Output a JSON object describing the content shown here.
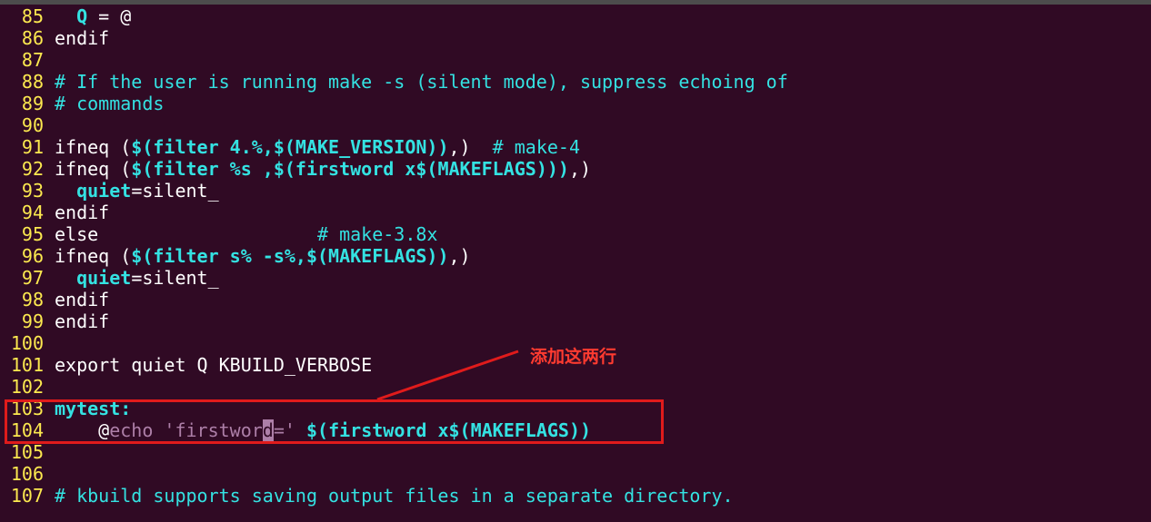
{
  "lines": [
    {
      "no": "85",
      "segs": [
        {
          "t": "  ",
          "c": ""
        },
        {
          "t": "Q",
          "c": "bcy"
        },
        {
          "t": " = @",
          "c": ""
        }
      ]
    },
    {
      "no": "86",
      "segs": [
        {
          "t": "endif",
          "c": "kw"
        }
      ]
    },
    {
      "no": "87",
      "segs": []
    },
    {
      "no": "88",
      "segs": [
        {
          "t": "# If the user is running make -s (silent mode), suppress echoing of",
          "c": "cmt"
        }
      ]
    },
    {
      "no": "89",
      "segs": [
        {
          "t": "# commands",
          "c": "cmt"
        }
      ]
    },
    {
      "no": "90",
      "segs": []
    },
    {
      "no": "91",
      "segs": [
        {
          "t": "ifneq (",
          "c": ""
        },
        {
          "t": "$(filter 4.%,$(MAKE_VERSION))",
          "c": "bcy"
        },
        {
          "t": ",)  ",
          "c": ""
        },
        {
          "t": "# make-4",
          "c": "cmt"
        }
      ]
    },
    {
      "no": "92",
      "segs": [
        {
          "t": "ifneq (",
          "c": ""
        },
        {
          "t": "$(filter %s ,$(firstword x$(MAKEFLAGS)))",
          "c": "bcy"
        },
        {
          "t": ",)",
          "c": ""
        }
      ]
    },
    {
      "no": "93",
      "segs": [
        {
          "t": "  ",
          "c": ""
        },
        {
          "t": "quiet",
          "c": "bcy"
        },
        {
          "t": "=silent_",
          "c": ""
        }
      ]
    },
    {
      "no": "94",
      "segs": [
        {
          "t": "endif",
          "c": "kw"
        }
      ]
    },
    {
      "no": "95",
      "segs": [
        {
          "t": "else                    ",
          "c": "kw"
        },
        {
          "t": "# make-3.8x",
          "c": "cmt"
        }
      ]
    },
    {
      "no": "96",
      "segs": [
        {
          "t": "ifneq (",
          "c": ""
        },
        {
          "t": "$(filter s% -s%,$(MAKEFLAGS))",
          "c": "bcy"
        },
        {
          "t": ",)",
          "c": ""
        }
      ]
    },
    {
      "no": "97",
      "segs": [
        {
          "t": "  ",
          "c": ""
        },
        {
          "t": "quiet",
          "c": "bcy"
        },
        {
          "t": "=silent_",
          "c": ""
        }
      ]
    },
    {
      "no": "98",
      "segs": [
        {
          "t": "endif",
          "c": "kw"
        }
      ]
    },
    {
      "no": "99",
      "segs": [
        {
          "t": "endif",
          "c": "kw"
        }
      ]
    },
    {
      "no": "100",
      "segs": []
    },
    {
      "no": "101",
      "segs": [
        {
          "t": "export quiet Q KBUILD_VERBOSE",
          "c": ""
        }
      ]
    },
    {
      "no": "102",
      "segs": []
    },
    {
      "no": "103",
      "segs": [
        {
          "t": "mytest:",
          "c": "bcy"
        }
      ]
    },
    {
      "no": "104",
      "segs": [
        {
          "t": "    @",
          "c": ""
        },
        {
          "t": "echo 'firstwor",
          "c": "str"
        },
        {
          "t": "d",
          "c": "cursor"
        },
        {
          "t": "='",
          "c": "str"
        },
        {
          "t": " ",
          "c": ""
        },
        {
          "t": "$(firstword x$(MAKEFLAGS))",
          "c": "bcy"
        }
      ]
    },
    {
      "no": "105",
      "segs": []
    },
    {
      "no": "106",
      "segs": []
    },
    {
      "no": "107",
      "segs": [
        {
          "t": "# kbuild supports saving output files in a separate directory.",
          "c": "cmt"
        }
      ]
    }
  ],
  "annotation": {
    "text": "添加这两行",
    "color": "#e01b1b"
  }
}
